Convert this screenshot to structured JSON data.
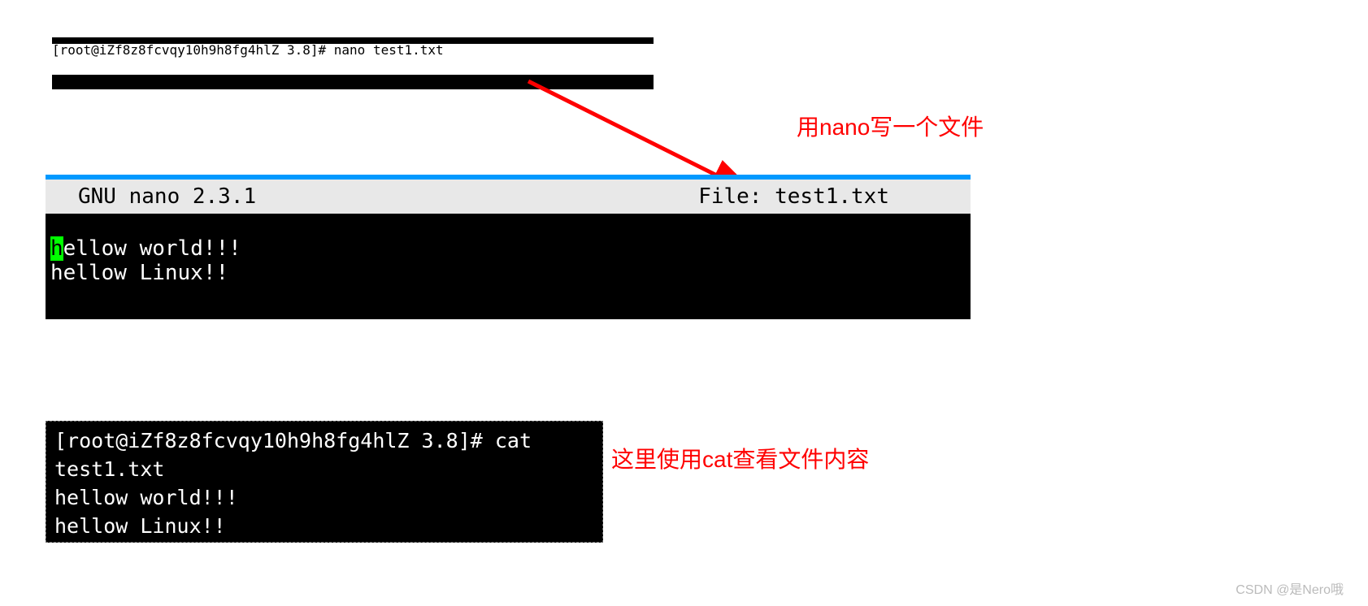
{
  "terminal1": {
    "prompt": "[root@iZf8z8fcvqy10h9h8fg4hlZ 3.8]# nano test1.txt"
  },
  "annotations": {
    "nano": "用nano写一个文件",
    "cat": "这里使用cat查看文件内容"
  },
  "nano": {
    "header_left": "GNU nano 2.3.1",
    "header_right": "File: test1.txt",
    "cursor_char": "h",
    "line1_rest": "ellow world!!!",
    "line2": "hellow Linux!!"
  },
  "terminal2": {
    "prompt": "[root@iZf8z8fcvqy10h9h8fg4hlZ 3.8]# cat test1.txt",
    "line1": "hellow world!!!",
    "line2": "hellow Linux!!"
  },
  "watermark": "CSDN @是Nero哦"
}
